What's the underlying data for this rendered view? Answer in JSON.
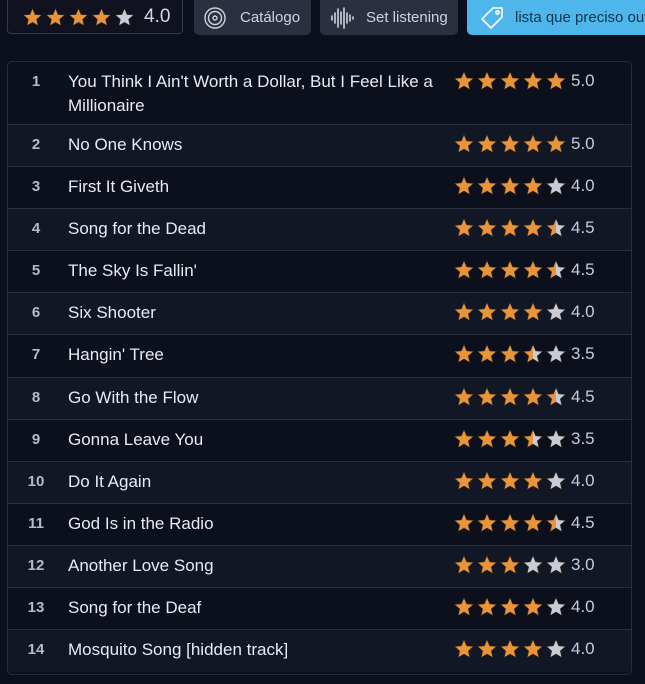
{
  "album_rating": {
    "stars": 4,
    "value": "4.0"
  },
  "chips": {
    "catalog": {
      "label": "Catálogo",
      "icon": "vinyl-icon"
    },
    "set_listening": {
      "label": "Set listening",
      "icon": "waveform-icon"
    },
    "list": {
      "label": "lista que preciso ouvir",
      "icon": "tag-icon"
    }
  },
  "colors": {
    "star_fill": "#e8943a",
    "star_empty": "#c9ccd6",
    "accent": "#4fb6ec",
    "background": "#0c0f1c"
  },
  "tracks": [
    {
      "num": "1",
      "title": "You Think I Ain't Worth a Dollar, But I Feel Like a Millionaire",
      "rating": 5.0,
      "score": "5.0"
    },
    {
      "num": "2",
      "title": "No One Knows",
      "rating": 5.0,
      "score": "5.0"
    },
    {
      "num": "3",
      "title": "First It Giveth",
      "rating": 4.0,
      "score": "4.0"
    },
    {
      "num": "4",
      "title": "Song for the Dead",
      "rating": 4.5,
      "score": "4.5"
    },
    {
      "num": "5",
      "title": "The Sky Is Fallin'",
      "rating": 4.5,
      "score": "4.5"
    },
    {
      "num": "6",
      "title": "Six Shooter",
      "rating": 4.0,
      "score": "4.0"
    },
    {
      "num": "7",
      "title": "Hangin' Tree",
      "rating": 3.5,
      "score": "3.5"
    },
    {
      "num": "8",
      "title": "Go With the Flow",
      "rating": 4.5,
      "score": "4.5"
    },
    {
      "num": "9",
      "title": "Gonna Leave You",
      "rating": 3.5,
      "score": "3.5"
    },
    {
      "num": "10",
      "title": "Do It Again",
      "rating": 4.0,
      "score": "4.0"
    },
    {
      "num": "11",
      "title": "God Is in the Radio",
      "rating": 4.5,
      "score": "4.5"
    },
    {
      "num": "12",
      "title": "Another Love Song",
      "rating": 3.0,
      "score": "3.0"
    },
    {
      "num": "13",
      "title": "Song for the Deaf",
      "rating": 4.0,
      "score": "4.0"
    },
    {
      "num": "14",
      "title": "Mosquito Song [hidden track]",
      "rating": 4.0,
      "score": "4.0"
    }
  ]
}
